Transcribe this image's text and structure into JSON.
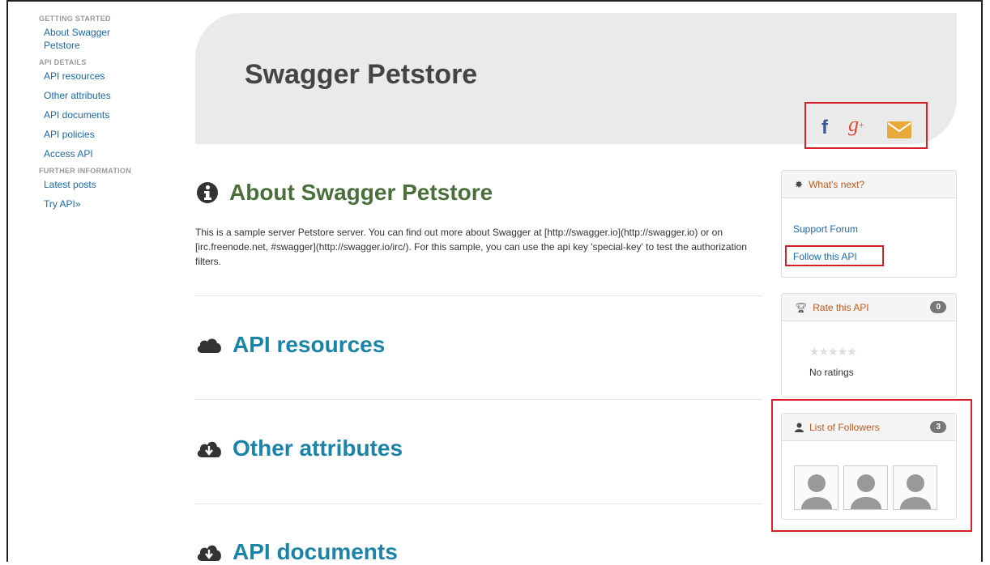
{
  "sidebar": {
    "groups": [
      {
        "heading": "GETTING STARTED",
        "items": [
          "About Swagger Petstore"
        ]
      },
      {
        "heading": "API DETAILS",
        "items": [
          "API resources",
          "Other attributes",
          "API documents",
          "API policies",
          "Access API"
        ]
      },
      {
        "heading": "FURTHER INFORMATION",
        "items": [
          "Latest posts",
          "Try API»"
        ]
      }
    ]
  },
  "banner": {
    "title": "Swagger Petstore"
  },
  "social": {
    "facebook_glyph": "f",
    "googleplus_glyph": "g",
    "googleplus_sup": "+"
  },
  "main": {
    "about_title": "About Swagger Petstore",
    "about_text": "This is a sample server Petstore server. You can find out more about Swagger at [http://swagger.io](http://swagger.io) or on [irc.freenode.net, #swagger](http://swagger.io/irc/). For this sample, you can use the api key 'special-key' to test the authorization filters.",
    "resources_title": "API resources",
    "attributes_title": "Other attributes",
    "documents_title": "API documents"
  },
  "panels": {
    "whats_next": {
      "title": "What's next?",
      "support_forum": "Support Forum",
      "follow": "Follow this API"
    },
    "rate": {
      "title": "Rate this API",
      "count": "0",
      "stars": "★★★★★",
      "no_ratings": "No ratings"
    },
    "followers": {
      "title": "List of Followers",
      "count": "3"
    }
  },
  "colors": {
    "accent_red": "#d8202a",
    "link_blue": "#1a6aa8",
    "heading_teal": "#1a84a8",
    "about_green": "#4a6f3a",
    "panel_orange": "#c4581a"
  }
}
